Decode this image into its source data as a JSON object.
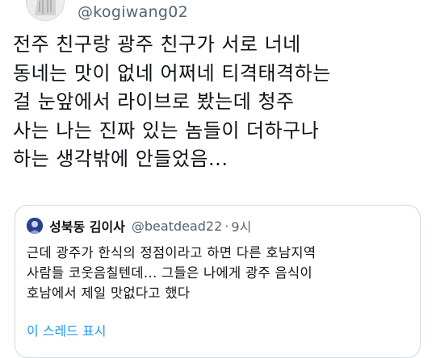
{
  "tweet": {
    "handle": "@kogiwang02",
    "lines": [
      "전주 친구랑 광주 친구가 서로 너네",
      "동네는 맛이 없네 어쩌네 티격태격하는",
      "걸 눈앞에서 라이브로 봤는데 청주",
      "사는 나는 진짜 있는 놈들이 더하구나",
      "하는 생각밖에 안들었음..."
    ]
  },
  "quote": {
    "display_name": "성북동 김이사",
    "handle": "@beatdead22",
    "separator": "·",
    "time": "9시",
    "lines": [
      "근데 광주가 한식의 정점이라고 하면 다른 호남지역",
      "사람들 코웃음칠텐데... 그들은 나에게 광주 음식이",
      "호남에서 제일 맛없다고 했다"
    ],
    "thread_link": "이 스레드 표시"
  },
  "colors": {
    "text": "#0f1419",
    "secondary": "#536471",
    "link": "#1d9bf0",
    "border": "#cfd9de"
  }
}
